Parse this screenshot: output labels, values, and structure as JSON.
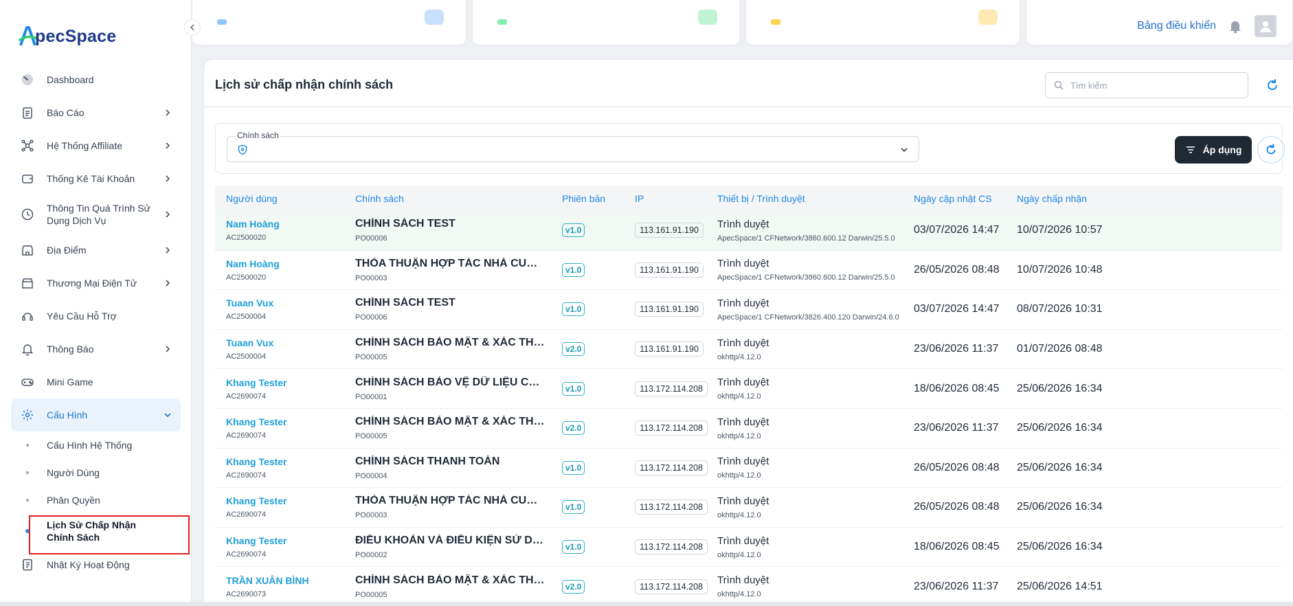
{
  "brand": {
    "name": "pecSpace",
    "initial": "A"
  },
  "sidebar": {
    "items": [
      {
        "label": "Dashboard",
        "icon": "gauge-icon",
        "has_children": false
      },
      {
        "label": "Báo Cáo",
        "icon": "clipboard-icon",
        "has_children": true
      },
      {
        "label": "Hệ Thống Affiliate",
        "icon": "network-icon",
        "has_children": true
      },
      {
        "label": "Thống Kê Tài Khoản",
        "icon": "wallet-icon",
        "has_children": true
      },
      {
        "label": "Thông Tin Quá Trình Sử Dụng Dịch Vụ",
        "icon": "clock-icon",
        "has_children": true
      },
      {
        "label": "Địa Điểm",
        "icon": "store-icon",
        "has_children": true
      },
      {
        "label": "Thương Mại Điện Tử",
        "icon": "shop-icon",
        "has_children": true
      },
      {
        "label": "Yêu Cầu Hỗ Trợ",
        "icon": "support-icon",
        "has_children": false
      },
      {
        "label": "Thông Báo",
        "icon": "bell-icon",
        "has_children": true
      },
      {
        "label": "Mini Game",
        "icon": "gamepad-icon",
        "has_children": false
      },
      {
        "label": "Cấu Hình",
        "icon": "gear-icon",
        "has_children": true,
        "expanded": true
      }
    ],
    "sub_items": [
      {
        "label": "Cấu Hình Hệ Thống"
      },
      {
        "label": "Người Dùng"
      },
      {
        "label": "Phân Quyền"
      },
      {
        "label": "Lịch Sử Chấp Nhận Chính Sách",
        "current": true
      }
    ],
    "last_item": {
      "label": "Nhật Ký Hoạt Động",
      "icon": "journal-icon"
    }
  },
  "topbar": {
    "dashboard_label": "Bảng điều khiển"
  },
  "page": {
    "title": "Lịch sử chấp nhận chính sách",
    "search_placeholder": "Tìm kiếm",
    "filter_label": "Chính sách",
    "apply_label": "Áp dụng"
  },
  "table": {
    "headers": {
      "user": "Người dùng",
      "policy": "Chính sách",
      "version": "Phiên bản",
      "ip": "IP",
      "device": "Thiết bị / Trình duyệt",
      "updated": "Ngày cập nhật CS",
      "accepted": "Ngày chấp nhận"
    },
    "rows": [
      {
        "user": "Nam Hoàng",
        "user_code": "AC2500020",
        "policy": "CHÍNH SÁCH TEST",
        "policy_code": "PO00006",
        "version": "v1.0",
        "ip": "113.161.91.190",
        "device": "Trình duyệt",
        "agent": "ApecSpace/1 CFNetwork/3860.600.12 Darwin/25.5.0",
        "updated": "03/07/2026 14:47",
        "accepted": "10/07/2026 10:57"
      },
      {
        "user": "Nam Hoàng",
        "user_code": "AC2500020",
        "policy": "THỎA THUẬN HỢP TÁC NHÀ CUNG CẤP",
        "policy_code": "PO00003",
        "version": "v1.0",
        "ip": "113.161.91.190",
        "device": "Trình duyệt",
        "agent": "ApecSpace/1 CFNetwork/3860.600.12 Darwin/25.5.0",
        "updated": "26/05/2026 08:48",
        "accepted": "10/07/2026 10:48"
      },
      {
        "user": "Tuaan Vux",
        "user_code": "AC2500004",
        "policy": "CHÍNH SÁCH TEST",
        "policy_code": "PO00006",
        "version": "v1.0",
        "ip": "113.161.91.190",
        "device": "Trình duyệt",
        "agent": "ApecSpace/1 CFNetwork/3826.400.120 Darwin/24.6.0",
        "updated": "03/07/2026 14:47",
        "accepted": "08/07/2026 10:31"
      },
      {
        "user": "Tuaan Vux",
        "user_code": "AC2500004",
        "policy": "CHÍNH SÁCH BẢO MẬT & XÁC THỰC e...",
        "policy_code": "PO00005",
        "version": "v2.0",
        "ip": "113.161.91.190",
        "device": "Trình duyệt",
        "agent": "okhttp/4.12.0",
        "updated": "23/06/2026 11:37",
        "accepted": "01/07/2026 08:48"
      },
      {
        "user": "Khang Tester",
        "user_code": "AC2690074",
        "policy": "CHÍNH SÁCH BẢO VỆ DỮ LIỆU CÁ NHÂN",
        "policy_code": "PO00001",
        "version": "v1.0",
        "ip": "113.172.114.208",
        "device": "Trình duyệt",
        "agent": "okhttp/4.12.0",
        "updated": "18/06/2026 08:45",
        "accepted": "25/06/2026 16:34"
      },
      {
        "user": "Khang Tester",
        "user_code": "AC2690074",
        "policy": "CHÍNH SÁCH BẢO MẬT & XÁC THỰC e...",
        "policy_code": "PO00005",
        "version": "v2.0",
        "ip": "113.172.114.208",
        "device": "Trình duyệt",
        "agent": "okhttp/4.12.0",
        "updated": "23/06/2026 11:37",
        "accepted": "25/06/2026 16:34"
      },
      {
        "user": "Khang Tester",
        "user_code": "AC2690074",
        "policy": "CHÍNH SÁCH THANH TOÁN",
        "policy_code": "PO00004",
        "version": "v1.0",
        "ip": "113.172.114.208",
        "device": "Trình duyệt",
        "agent": "okhttp/4.12.0",
        "updated": "26/05/2026 08:48",
        "accepted": "25/06/2026 16:34"
      },
      {
        "user": "Khang Tester",
        "user_code": "AC2690074",
        "policy": "THỎA THUẬN HỢP TÁC NHÀ CUNG CẤP",
        "policy_code": "PO00003",
        "version": "v1.0",
        "ip": "113.172.114.208",
        "device": "Trình duyệt",
        "agent": "okhttp/4.12.0",
        "updated": "26/05/2026 08:48",
        "accepted": "25/06/2026 16:34"
      },
      {
        "user": "Khang Tester",
        "user_code": "AC2690074",
        "policy": "ĐIỀU KHOẢN VÀ ĐIỀU KIỆN SỬ DỤNG ...",
        "policy_code": "PO00002",
        "version": "v1.0",
        "ip": "113.172.114.208",
        "device": "Trình duyệt",
        "agent": "okhttp/4.12.0",
        "updated": "18/06/2026 08:45",
        "accepted": "25/06/2026 16:34"
      },
      {
        "user": "TRẦN XUÂN BÌNH",
        "user_code": "AC2690073",
        "policy": "CHÍNH SÁCH BẢO MẬT & XÁC THỰC e...",
        "policy_code": "PO00005",
        "version": "v2.0",
        "ip": "113.172.114.208",
        "device": "Trình duyệt",
        "agent": "okhttp/4.12.0",
        "updated": "23/06/2026 11:37",
        "accepted": "25/06/2026 14:51"
      }
    ]
  }
}
